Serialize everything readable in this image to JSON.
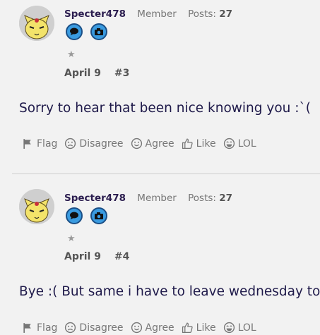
{
  "posts": [
    {
      "username": "Specter478",
      "role": "Member",
      "posts_label": "Posts:",
      "posts_count": "27",
      "date": "April 9",
      "post_number": "#3",
      "message": "Sorry to hear that been nice knowing you :`(",
      "actions": {
        "flag": "Flag",
        "disagree": "Disagree",
        "agree": "Agree",
        "like": "Like",
        "lol": "LOL"
      }
    },
    {
      "username": "Specter478",
      "role": "Member",
      "posts_label": "Posts:",
      "posts_count": "27",
      "date": "April 9",
      "post_number": "#4",
      "message": "Bye :( But same i have to leave wednesday to:<",
      "actions": {
        "flag": "Flag",
        "disagree": "Disagree",
        "agree": "Agree",
        "like": "Like",
        "lol": "LOL"
      }
    }
  ],
  "icons": {
    "badge_1": "speech-bubble-icon",
    "badge_2": "camera-icon",
    "rank": "star-icon",
    "flag": "flag-icon",
    "disagree": "frown-icon",
    "agree": "smile-icon",
    "like": "thumbs-up-icon",
    "lol": "laugh-icon"
  },
  "colors": {
    "background": "#f2f2f2",
    "username": "#2b1d4f",
    "badge_fill": "#3a9be0",
    "badge_border": "#1b4f86",
    "message_text": "#1f1a4a",
    "action_text": "#777777"
  }
}
